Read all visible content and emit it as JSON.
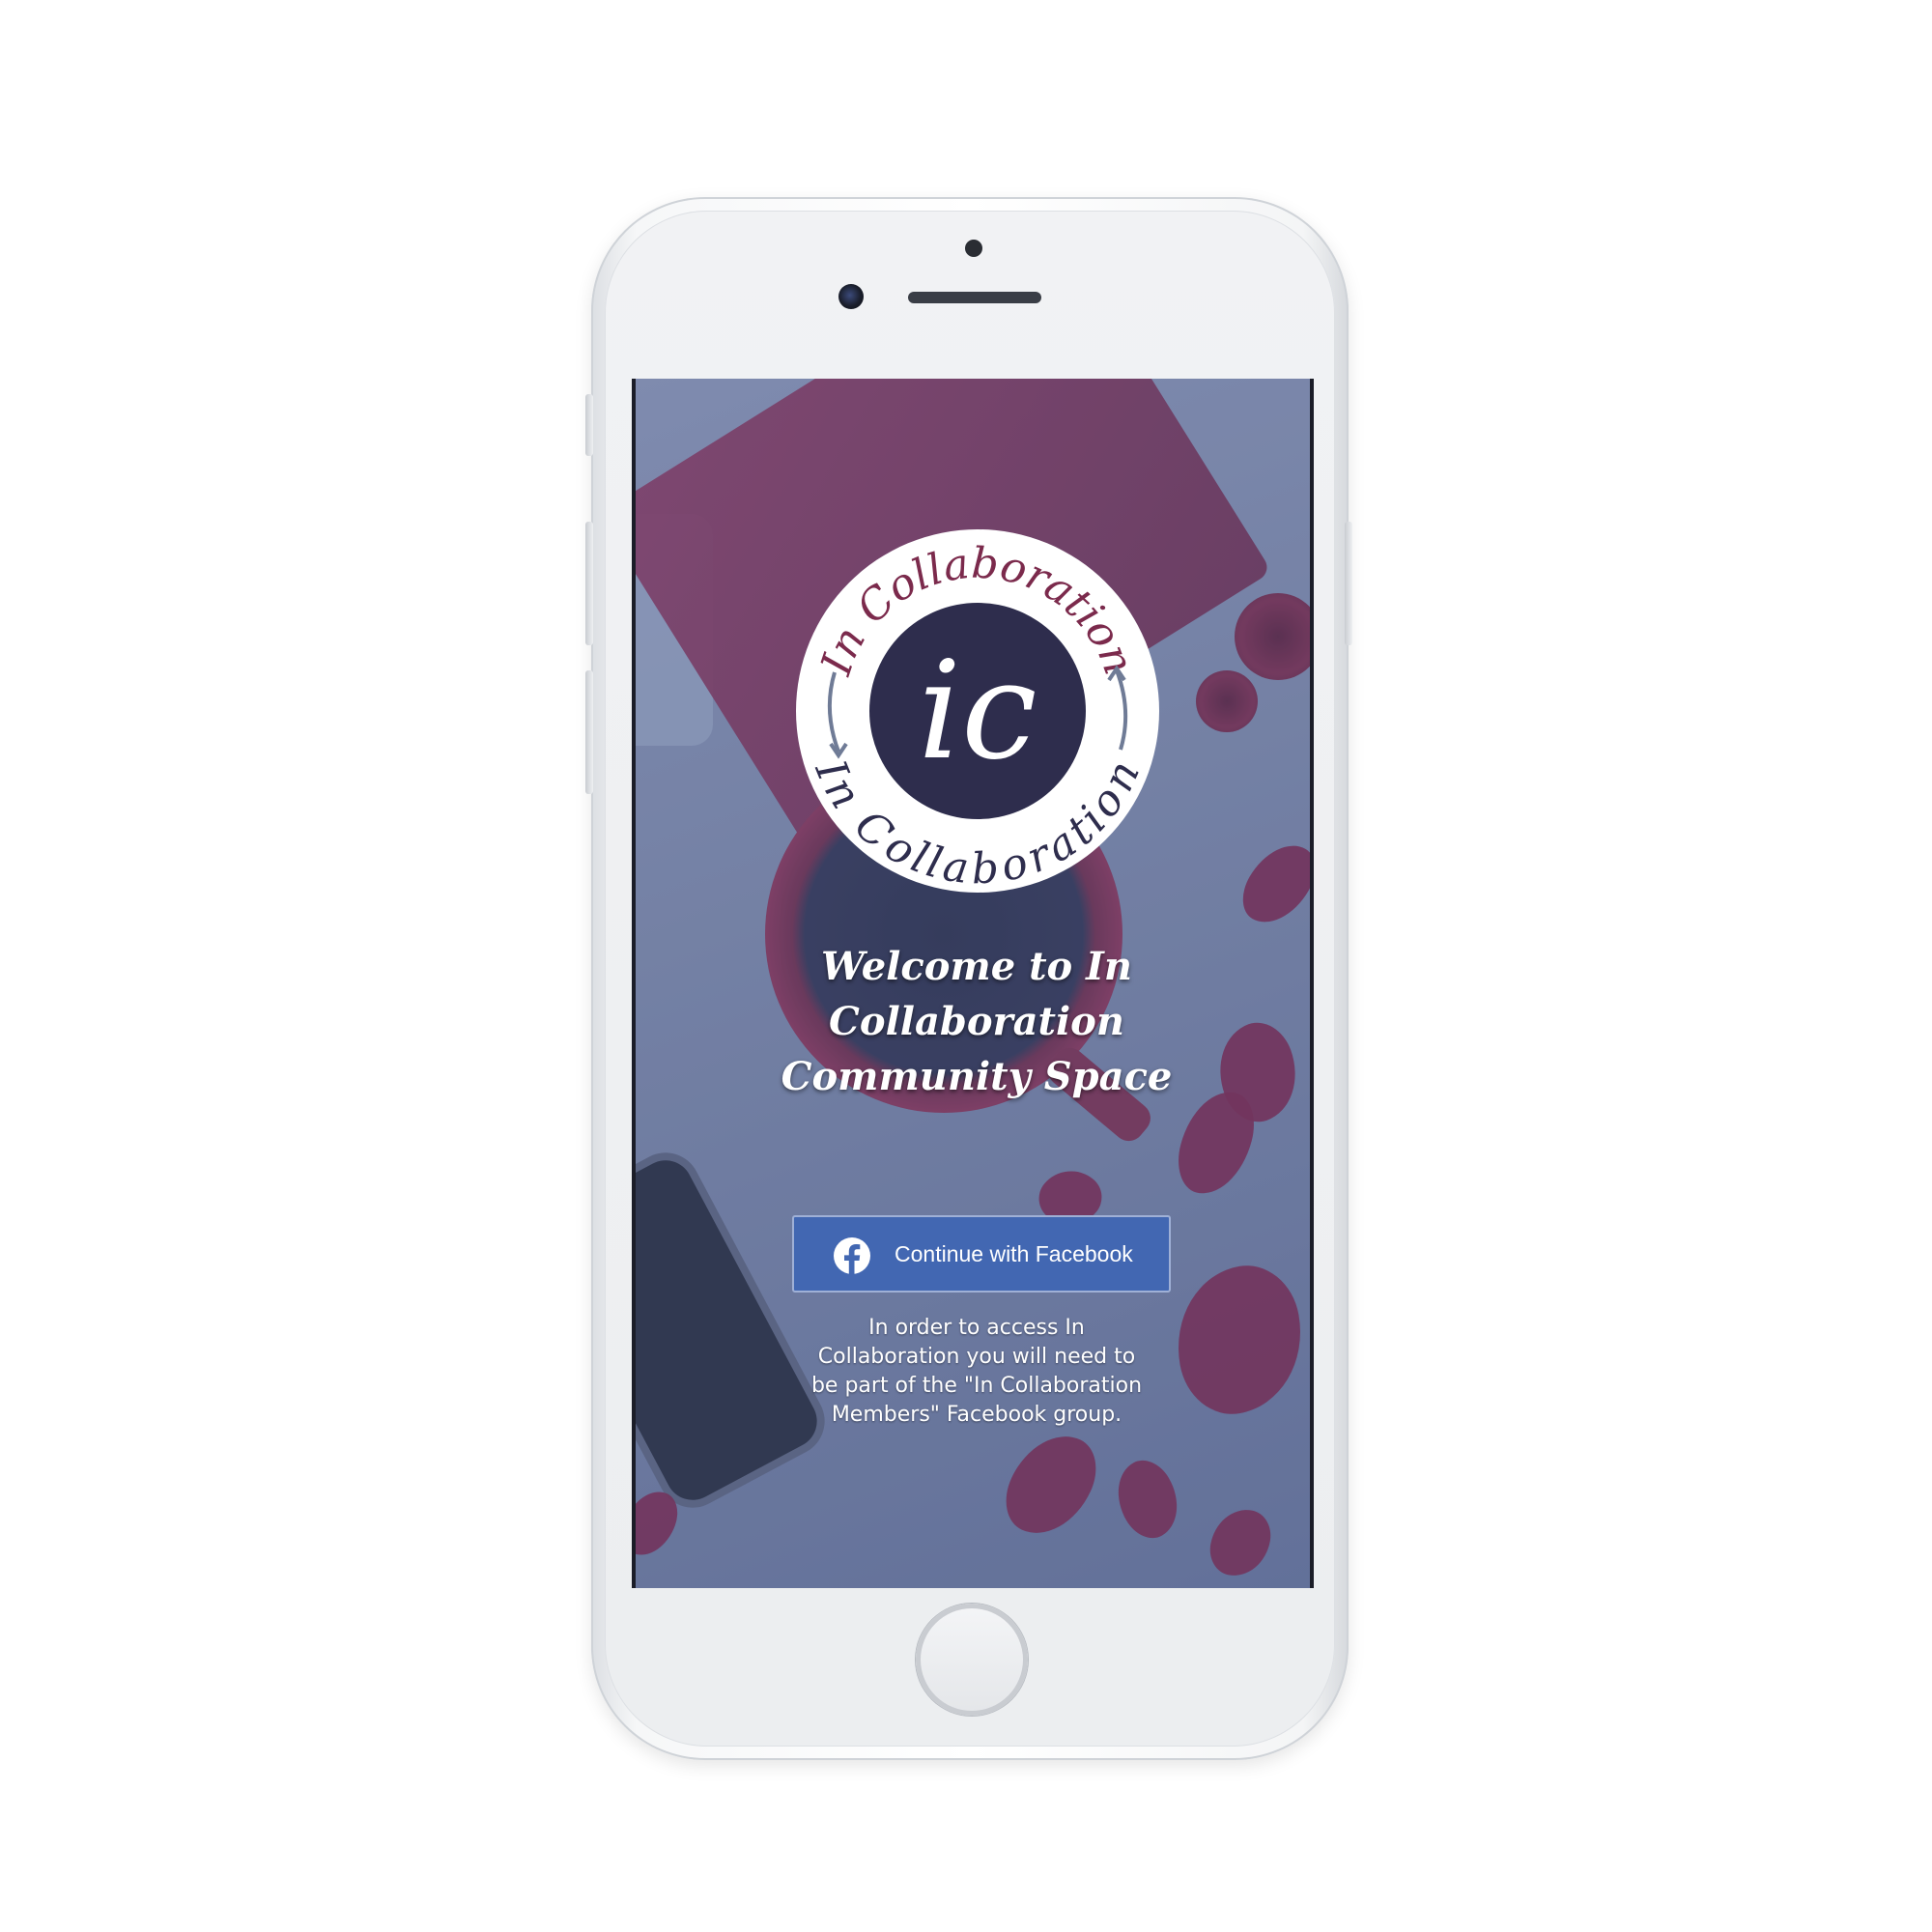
{
  "welcome": {
    "title": "Welcome to In Collaboration Community Space"
  },
  "logo": {
    "top_text": "In Collaboration",
    "bottom_text": "In Collaboration",
    "monogram": "ic"
  },
  "login": {
    "facebook_label": "Continue with Facebook",
    "facebook_icon": "facebook-icon"
  },
  "info": {
    "text": "In order to access In Collaboration you will need to be part of the \"In Collaboration Members\" Facebook group."
  },
  "colors": {
    "facebook_blue": "#4267b2",
    "logo_ring": "#ffffff",
    "logo_center": "#2e2d4d",
    "logo_text_maroon": "#7b2a4c",
    "logo_text_navy": "#2e2d4d",
    "logo_arrow": "#6f7b96"
  }
}
